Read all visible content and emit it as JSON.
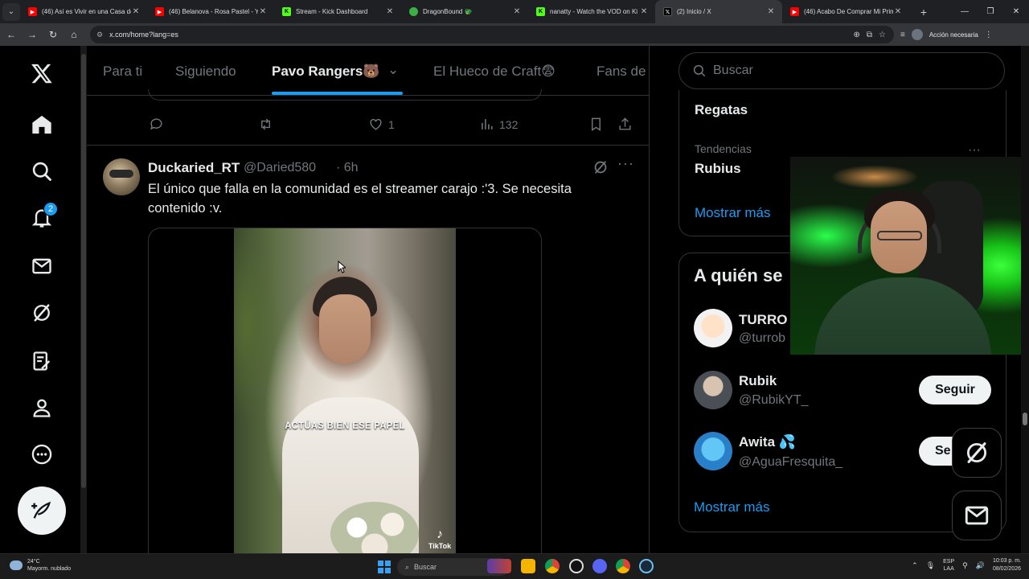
{
  "browser": {
    "tabs": [
      {
        "title": "(46) Así es Vivir en una Casa de",
        "favicon": "youtube-icon",
        "color": "#ff0000"
      },
      {
        "title": "(46) Belanova - Rosa Pastel - Yo",
        "favicon": "youtube-icon",
        "color": "#ff0000"
      },
      {
        "title": "Stream - Kick Dashboard",
        "favicon": "kick-icon",
        "color": "#53fc18"
      },
      {
        "title": "DragonBound 🐲",
        "favicon": "dragonbound-icon",
        "color": "#3cb043"
      },
      {
        "title": "nanatty - Watch the VOD on Ki",
        "favicon": "kick-icon",
        "color": "#53fc18"
      },
      {
        "title": "(2) Inicio / X",
        "favicon": "x-icon",
        "color": "#000000"
      },
      {
        "title": "(46) Acabo De Comprar Mi Prim",
        "favicon": "youtube-icon",
        "color": "#ff0000"
      }
    ],
    "active_tab_index": 5,
    "url": "x.com/home?lang=es",
    "action_required": "Acción necesaria"
  },
  "x": {
    "nav": {
      "notifications_count": "2",
      "icons": [
        "x-logo-icon",
        "home-icon",
        "search-icon",
        "bell-icon",
        "mail-icon",
        "grok-icon",
        "lists-icon",
        "profile-icon",
        "more-icon",
        "post-icon"
      ]
    },
    "feed_tabs": [
      {
        "label": "Para ti",
        "active": false
      },
      {
        "label": "Siguiendo",
        "active": false
      },
      {
        "label": "Pavo Rangers🐻",
        "active": true
      },
      {
        "label": "El Hueco de Craft😨",
        "active": false
      },
      {
        "label": "Fans de",
        "active": false
      }
    ],
    "previous_post": {
      "likes": "1",
      "views": "132"
    },
    "post": {
      "name": "Duckaried_RT",
      "handle": "@Daried580",
      "time": "· 6h",
      "text": "El único que falla en la comunidad es el streamer carajo :'3. Se necesita contenido :v.",
      "video_caption": "ACTÚAS BIEN ESE PAPEL",
      "watermark": "TikTok"
    },
    "search": {
      "placeholder": "Buscar"
    },
    "trends": {
      "title": "Regatas",
      "context": "Tendencias",
      "name": "Rubius",
      "show_more": "Mostrar más"
    },
    "who_to_follow": {
      "title": "A quién se",
      "accounts": [
        {
          "name": "TURRO",
          "handle": "@turrob",
          "button": ""
        },
        {
          "name": "Rubik",
          "handle": "@RubikYT_",
          "button": "Seguir"
        },
        {
          "name": "Awita 💦",
          "handle": "@AguaFresquita_",
          "button": "Se"
        }
      ],
      "show_more": "Mostrar más"
    }
  },
  "taskbar": {
    "weather_temp": "24°C",
    "weather_desc": "Mayorm. nublado",
    "search": "Buscar",
    "lang": "ESP",
    "lang2": "LAA",
    "time": "10:03 p. m.",
    "date": "08/02/2026"
  }
}
